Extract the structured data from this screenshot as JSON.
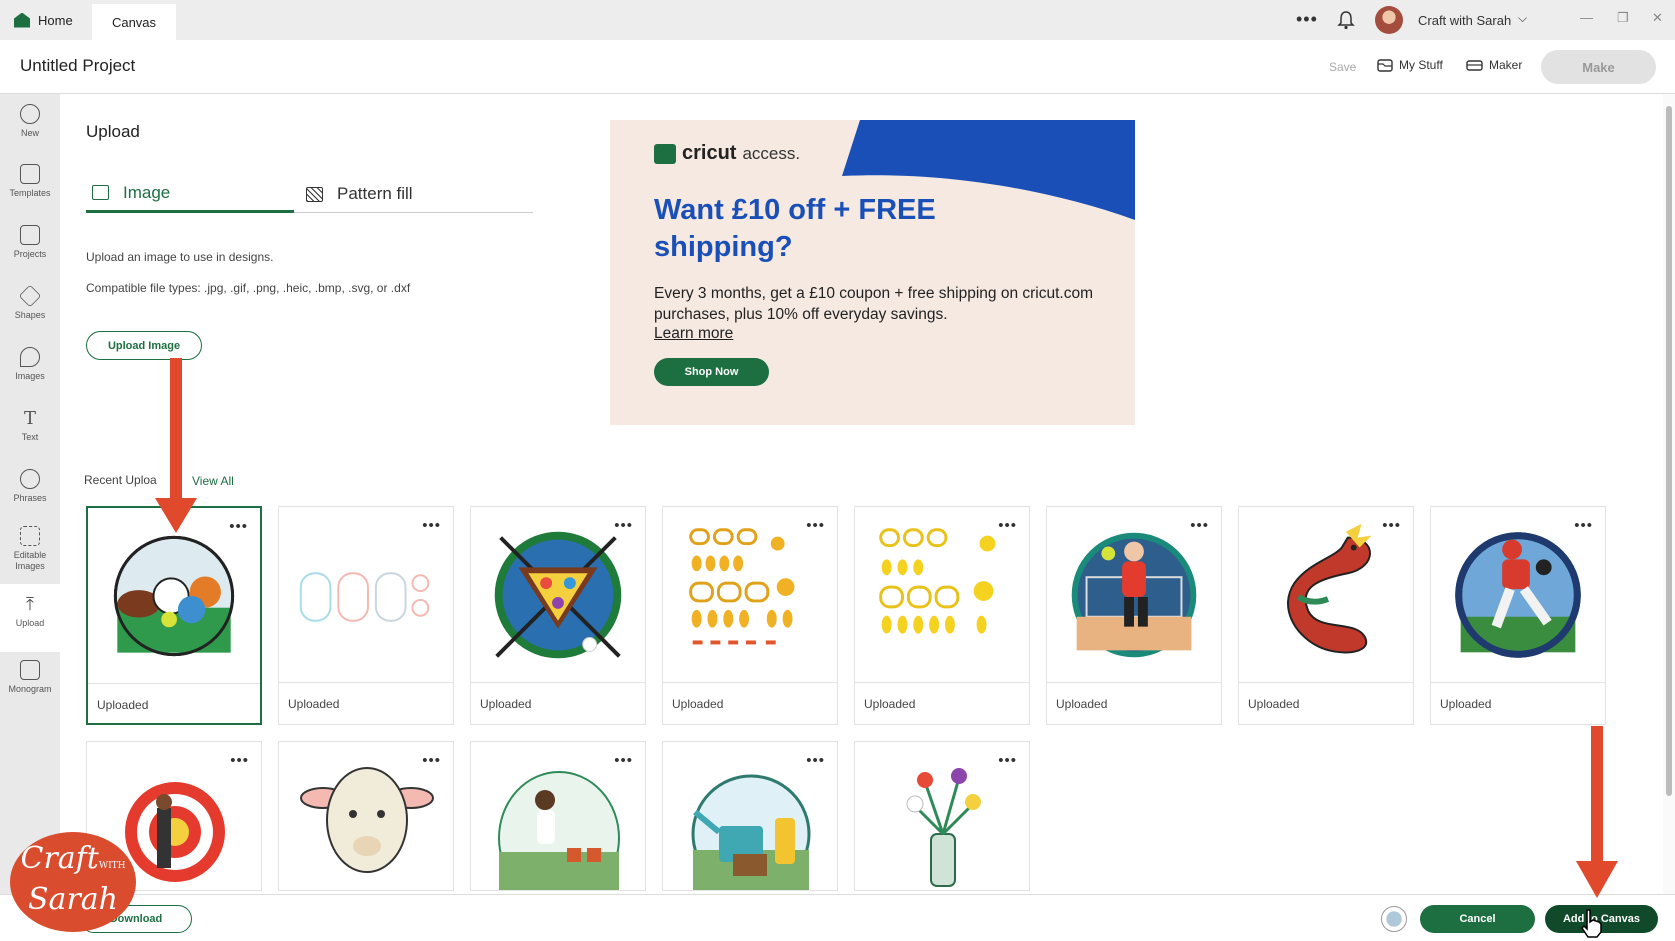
{
  "tabs": {
    "home": "Home",
    "canvas": "Canvas"
  },
  "topbar": {
    "more": "•••",
    "user_name": "Craft with Sarah",
    "chevron": "⌵",
    "min": "—",
    "restore": "❐",
    "close": "✕"
  },
  "header": {
    "project_title": "Untitled Project",
    "save": "Save",
    "my_stuff": "My Stuff",
    "maker": "Maker",
    "make": "Make"
  },
  "sidebar": {
    "items": [
      {
        "label": "New"
      },
      {
        "label": "Templates"
      },
      {
        "label": "Projects"
      },
      {
        "label": "Shapes"
      },
      {
        "label": "Images"
      },
      {
        "label": "Text"
      },
      {
        "label": "Phrases"
      },
      {
        "label": "Editable Images"
      },
      {
        "label": "Upload"
      },
      {
        "label": "Monogram"
      }
    ]
  },
  "upload": {
    "title": "Upload",
    "tab_image": "Image",
    "tab_pattern": "Pattern fill",
    "desc1": "Upload an image to use in designs.",
    "desc2": "Compatible file types: .jpg, .gif, .png, .heic, .bmp, .svg, or .dxf",
    "upload_button": "Upload Image",
    "recent_label": "Recent Uploa",
    "view_all": "View All"
  },
  "ad": {
    "logo_bold": "cricut",
    "logo_light": "access.",
    "headline": "Want £10 off + FREE shipping?",
    "body": "Every 3 months, get a £10 coupon + free shipping on cricut.com purchases, plus 10% off everyday savings.",
    "learn_more": "Learn more",
    "shop_now": "Shop Now"
  },
  "recent_uploads": [
    {
      "caption": "Uploaded",
      "subject": "sports-balls"
    },
    {
      "caption": "Uploaded",
      "subject": "outlines"
    },
    {
      "caption": "Uploaded",
      "subject": "billiards"
    },
    {
      "caption": "Uploaded",
      "subject": "gold-shapes"
    },
    {
      "caption": "Uploaded",
      "subject": "gold-shapes-2"
    },
    {
      "caption": "Uploaded",
      "subject": "handball-player"
    },
    {
      "caption": "Uploaded",
      "subject": "dragon"
    },
    {
      "caption": "Uploaded",
      "subject": "baseball-player"
    }
  ],
  "row2": [
    {
      "subject": "archery"
    },
    {
      "subject": "lamb"
    },
    {
      "subject": "gardener"
    },
    {
      "subject": "watering-can"
    },
    {
      "subject": "flower-vase"
    }
  ],
  "card_more": "•••",
  "bottom": {
    "download": "Download",
    "cancel": "Cancel",
    "add_to_canvas": "Add to Canvas"
  },
  "watermark": {
    "line1": "Craft",
    "line2": "Sarah",
    "with": "WITH"
  },
  "colors": {
    "brand_green": "#1d6f42",
    "ad_blue": "#1a4fb8",
    "arrow_red": "#e0492b"
  }
}
